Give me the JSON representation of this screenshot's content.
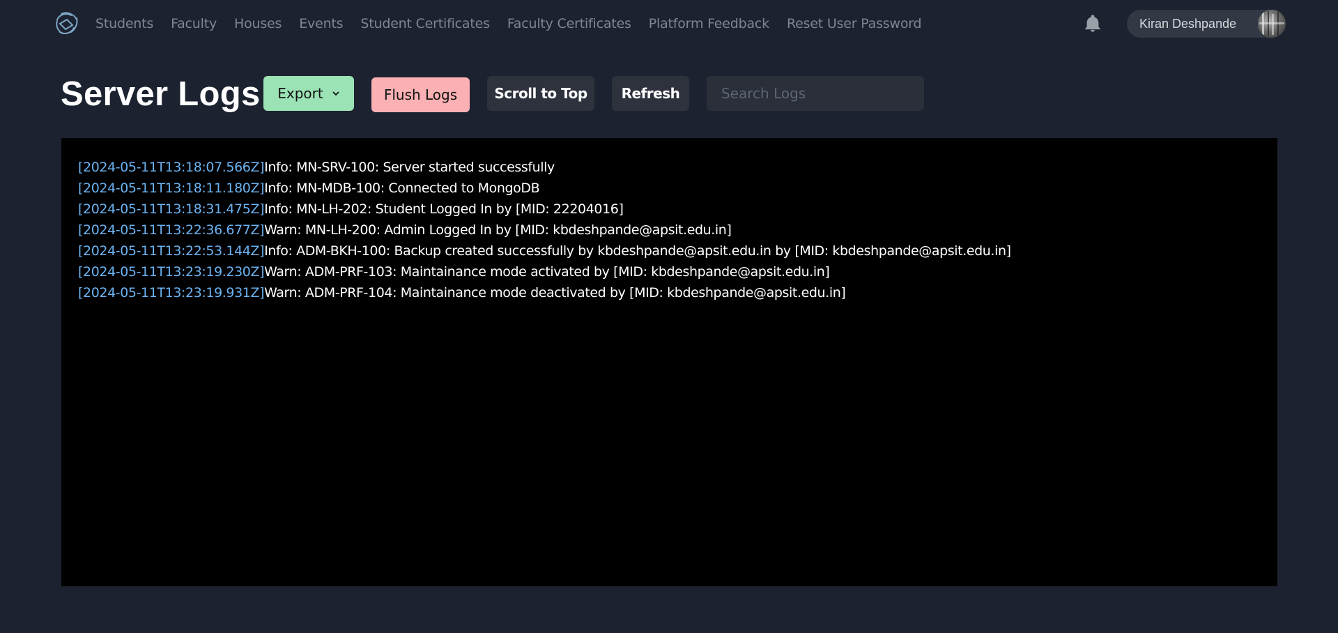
{
  "nav": {
    "links": [
      "Students",
      "Faculty",
      "Houses",
      "Events",
      "Student Certificates",
      "Faculty Certificates",
      "Platform Feedback",
      "Reset User Password"
    ],
    "user_name": "Kiran Deshpande"
  },
  "toolbar": {
    "title": "Server Logs",
    "export_label": "Export",
    "flush_label": "Flush Logs",
    "scroll_top_label": "Scroll to Top",
    "refresh_label": "Refresh",
    "search_placeholder": "Search Logs"
  },
  "logs": [
    {
      "ts": "[2024-05-11T13:18:07.566Z]",
      "msg": "Info: MN-SRV-100: Server started successfully"
    },
    {
      "ts": "[2024-05-11T13:18:11.180Z]",
      "msg": "Info: MN-MDB-100: Connected to MongoDB"
    },
    {
      "ts": "[2024-05-11T13:18:31.475Z]",
      "msg": "Info: MN-LH-202: Student Logged In by [MID: 22204016]"
    },
    {
      "ts": "[2024-05-11T13:22:36.677Z]",
      "msg": "Warn: MN-LH-200: Admin Logged In by [MID: kbdeshpande@apsit.edu.in]"
    },
    {
      "ts": "[2024-05-11T13:22:53.144Z]",
      "msg": "Info: ADM-BKH-100: Backup created successfully by kbdeshpande@apsit.edu.in by [MID: kbdeshpande@apsit.edu.in]"
    },
    {
      "ts": "[2024-05-11T13:23:19.230Z]",
      "msg": "Warn: ADM-PRF-103: Maintainance mode activated by [MID: kbdeshpande@apsit.edu.in]"
    },
    {
      "ts": "[2024-05-11T13:23:19.931Z]",
      "msg": "Warn: ADM-PRF-104: Maintainance mode deactivated by [MID: kbdeshpande@apsit.edu.in]"
    }
  ],
  "icons": {
    "logo": "logo-icon",
    "notifications": "bell-icon",
    "export_chevron": "chevron-down-icon"
  },
  "colors": {
    "background": "#1c2230",
    "log_background": "#000000",
    "timestamp": "#6bb3f2",
    "export_button": "#9be3b5",
    "flush_button": "#fbb1b3",
    "secondary_button": "#2d323d"
  }
}
